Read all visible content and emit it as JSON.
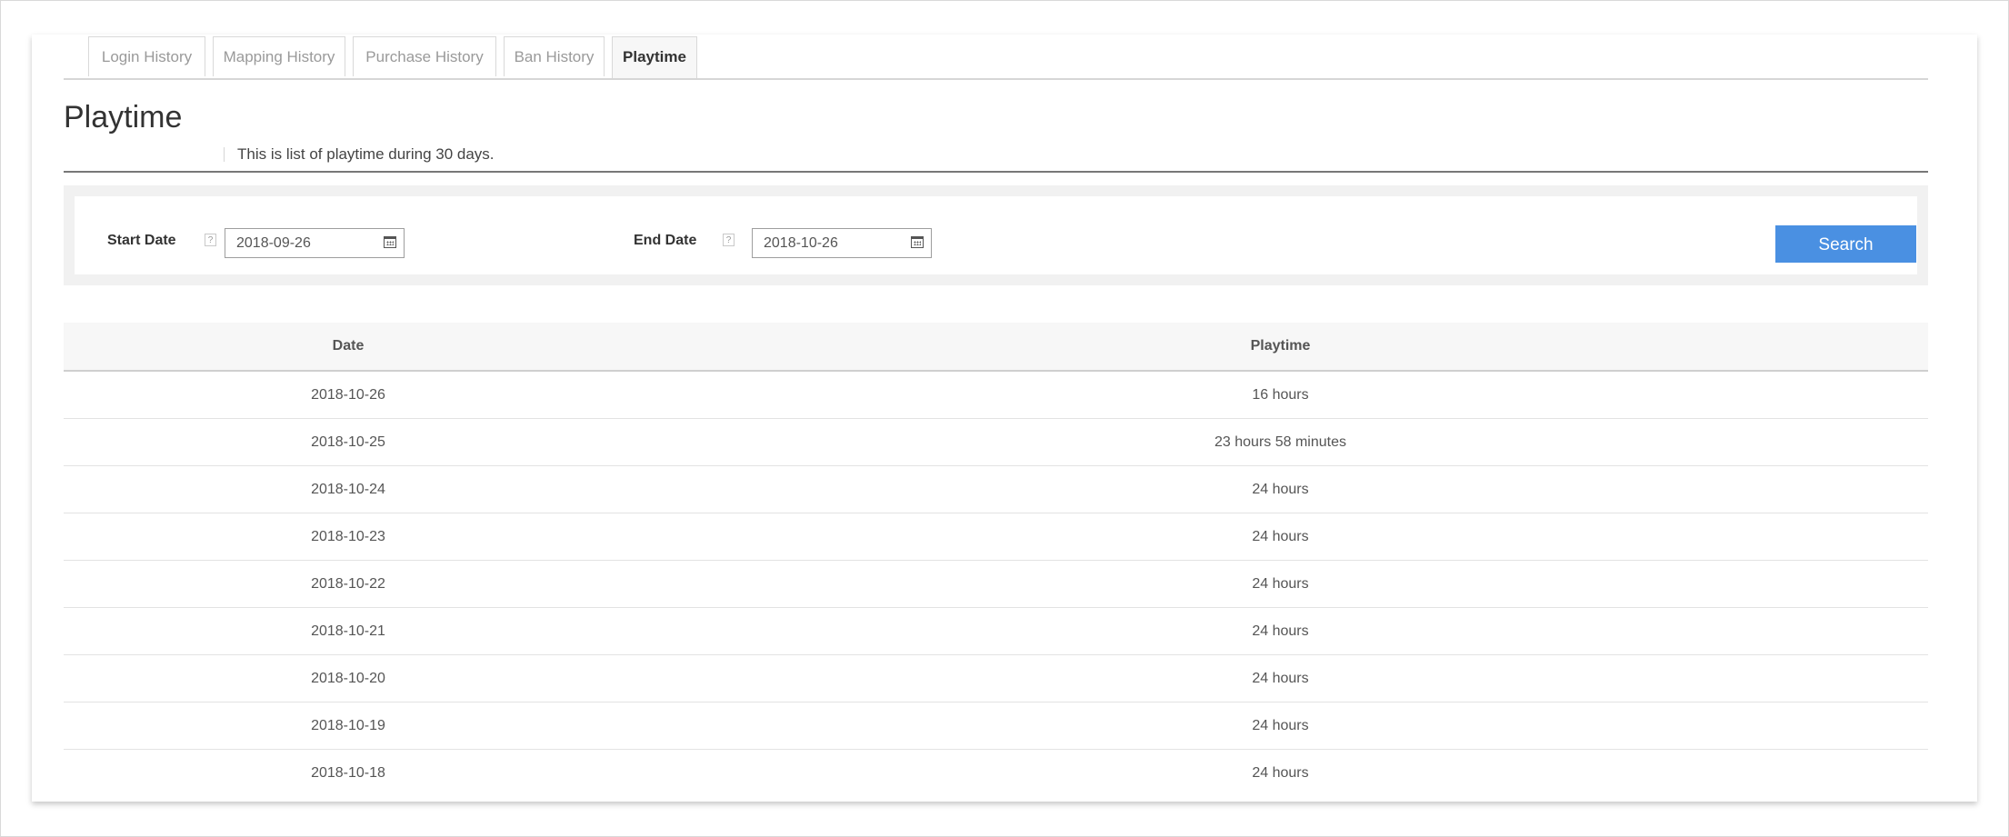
{
  "tabs": [
    {
      "label": "Login History",
      "active": false
    },
    {
      "label": "Mapping History",
      "active": false
    },
    {
      "label": "Purchase History",
      "active": false
    },
    {
      "label": "Ban History",
      "active": false
    },
    {
      "label": "Playtime",
      "active": true
    }
  ],
  "header": {
    "title": "Playtime",
    "subtitle": "This is list of playtime during 30 days."
  },
  "filter": {
    "start_label": "Start Date",
    "start_value": "2018-09-26",
    "end_label": "End Date",
    "end_value": "2018-10-26",
    "help_glyph": "?",
    "search_label": "Search"
  },
  "table": {
    "columns": [
      "Date",
      "Playtime"
    ],
    "rows": [
      {
        "date": "2018-10-26",
        "playtime": "16 hours"
      },
      {
        "date": "2018-10-25",
        "playtime": "23 hours 58 minutes"
      },
      {
        "date": "2018-10-24",
        "playtime": "24 hours"
      },
      {
        "date": "2018-10-23",
        "playtime": "24 hours"
      },
      {
        "date": "2018-10-22",
        "playtime": "24 hours"
      },
      {
        "date": "2018-10-21",
        "playtime": "24 hours"
      },
      {
        "date": "2018-10-20",
        "playtime": "24 hours"
      },
      {
        "date": "2018-10-19",
        "playtime": "24 hours"
      },
      {
        "date": "2018-10-18",
        "playtime": "24 hours"
      }
    ]
  },
  "colors": {
    "accent": "#4a90e2",
    "header_rule": "#777777",
    "filter_bg": "#f1f1f1"
  },
  "icons": {
    "date_picker": "calendar-icon",
    "help": "help-icon"
  }
}
